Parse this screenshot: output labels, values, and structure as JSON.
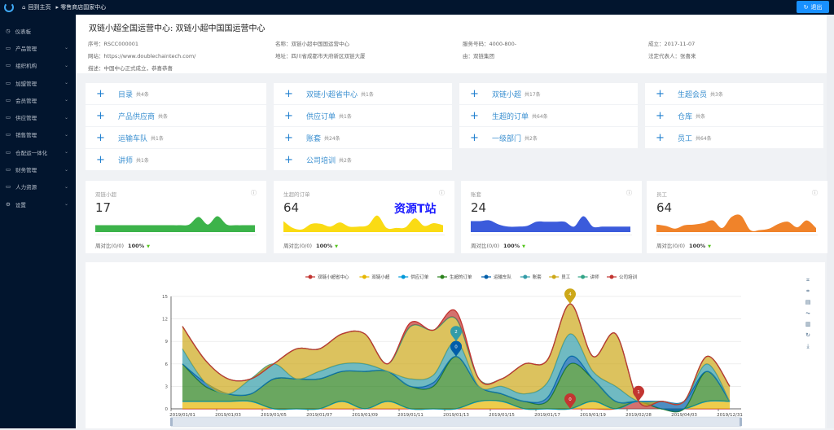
{
  "topbar": {
    "home": "回到主页",
    "breadcrumb": "零售商店国家中心",
    "logout": "退出"
  },
  "sidebar": {
    "items": [
      {
        "label": "仪表板",
        "icon": "dashboard-icon",
        "expandable": false
      },
      {
        "label": "产品管理",
        "icon": "folder-icon",
        "expandable": true
      },
      {
        "label": "组织机构",
        "icon": "folder-icon",
        "expandable": true
      },
      {
        "label": "加盟管理",
        "icon": "folder-icon",
        "expandable": true
      },
      {
        "label": "会员管理",
        "icon": "folder-icon",
        "expandable": true
      },
      {
        "label": "供应管理",
        "icon": "folder-icon",
        "expandable": true
      },
      {
        "label": "销售管理",
        "icon": "folder-icon",
        "expandable": true
      },
      {
        "label": "仓配运一体化",
        "icon": "folder-icon",
        "expandable": true
      },
      {
        "label": "财务管理",
        "icon": "folder-icon",
        "expandable": true
      },
      {
        "label": "人力资源",
        "icon": "folder-icon",
        "expandable": true
      },
      {
        "label": "设置",
        "icon": "gear-icon",
        "expandable": true
      }
    ]
  },
  "header": {
    "title": "双链小超全国运营中心: 双链小超中国国运营中心",
    "fields": [
      {
        "label": "序号：",
        "value": "RSCC000001"
      },
      {
        "label": "名称：",
        "value": "双链小超中国国运营中心"
      },
      {
        "label": "服务号码：",
        "value": "4000-800-"
      },
      {
        "label": "成立：",
        "value": "2017-11-07"
      },
      {
        "label": "网站：",
        "value": "https://www.doublechaintech.com/"
      },
      {
        "label": "地址：",
        "value": "四川省成都市天府新区双链大厦"
      },
      {
        "label": "由：",
        "value": "双链集团"
      },
      {
        "label": "法定代表人：",
        "value": "张喜来"
      },
      {
        "label": "描述：",
        "value": "中国中心正式成立，恭喜恭喜"
      }
    ]
  },
  "grid": [
    {
      "label": "目录",
      "count": "共4条"
    },
    {
      "label": "双链小超省中心",
      "count": "共1条"
    },
    {
      "label": "双链小超",
      "count": "共17条"
    },
    {
      "label": "生超会员",
      "count": "共3条"
    },
    {
      "label": "产品供应商",
      "count": "共条"
    },
    {
      "label": "供应订单",
      "count": "共1条"
    },
    {
      "label": "生超的订单",
      "count": "共64条"
    },
    {
      "label": "仓库",
      "count": "共条"
    },
    {
      "label": "运输车队",
      "count": "共1条"
    },
    {
      "label": "账套",
      "count": "共24条"
    },
    {
      "label": "一级部门",
      "count": "共2条"
    },
    {
      "label": "员工",
      "count": "共64条"
    },
    {
      "label": "讲师",
      "count": "共1条"
    },
    {
      "label": "公司培训",
      "count": "共2条"
    }
  ],
  "stats": [
    {
      "title": "双链小超",
      "value": "17",
      "compare": "周对比(0/0)",
      "percent": "100%",
      "color": "#3cb34a",
      "spark": [
        1,
        1,
        1,
        1,
        1,
        1,
        1,
        1,
        1,
        1,
        1.1,
        2.2,
        1.1,
        2.3,
        1.1,
        1,
        1,
        1
      ]
    },
    {
      "title": "生超的订单",
      "value": "64",
      "compare": "周对比(0/0)",
      "percent": "100%",
      "color": "#fadb14",
      "spark": [
        1.6,
        0.6,
        0.4,
        1.2,
        1.2,
        0.8,
        1.4,
        0.8,
        0.8,
        1,
        2.4,
        0.6,
        0.6,
        0.7,
        2,
        0.9,
        1.3,
        1
      ]
    },
    {
      "title": "账套",
      "value": "24",
      "compare": "周对比(0/0)",
      "percent": "100%",
      "color": "#3b5bdb",
      "spark": [
        1.6,
        1.6,
        1.7,
        1.1,
        0.8,
        0.8,
        0.9,
        1.5,
        1.5,
        1.5,
        1.5,
        0.8,
        2.3,
        0.8,
        0.8,
        0.8,
        0.8,
        0.8
      ]
    },
    {
      "title": "员工",
      "value": "64",
      "compare": "周对比(0/0)",
      "percent": "100%",
      "color": "#f0832a",
      "spark": [
        1.1,
        0.9,
        0.5,
        1,
        1.1,
        1.3,
        1.7,
        0.6,
        2.2,
        2.4,
        0.3,
        0.3,
        0.5,
        1.2,
        1.5,
        0.7,
        1.7,
        0.6
      ]
    }
  ],
  "watermark": "资源T站",
  "chart_data": {
    "type": "area",
    "stacked": true,
    "smooth": true,
    "categories": [
      "2019/01/01",
      "2019/01/02",
      "2019/01/03",
      "2019/01/04",
      "2019/01/05",
      "2019/01/06",
      "2019/01/07",
      "2019/01/08",
      "2019/01/09",
      "2019/01/10",
      "2019/01/11",
      "2019/01/12",
      "2019/01/13",
      "2019/01/14",
      "2019/01/15",
      "2019/01/16",
      "2019/01/17",
      "2019/01/18",
      "2019/01/19",
      "2019/01/20",
      "2019/02/28",
      "",
      "2019/04/03",
      "",
      "2019/12/31"
    ],
    "tick_labels": [
      "2019/01/01",
      "2019/01/03",
      "2019/01/05",
      "2019/01/07",
      "2019/01/09",
      "2019/01/11",
      "2019/01/13",
      "2019/01/15",
      "2019/01/17",
      "2019/01/19",
      "2019/02/28",
      "2019/04/03",
      "2019/12/31"
    ],
    "ylim": [
      0,
      15
    ],
    "yticks": [
      0,
      3,
      6,
      9,
      12,
      15
    ],
    "grid": true,
    "legend_position": "top",
    "series": [
      {
        "name": "双链小超省中心",
        "color": "#c23531",
        "values": [
          0,
          0,
          0,
          0,
          0,
          0,
          0,
          0,
          0,
          0,
          0,
          0,
          0,
          0,
          0,
          0,
          0,
          0,
          0,
          0,
          1,
          0,
          0,
          0,
          0
        ]
      },
      {
        "name": "双链小超",
        "color": "#e6b600",
        "values": [
          1,
          1,
          1,
          1,
          0,
          0,
          0,
          1,
          0,
          1,
          0,
          0,
          0,
          1,
          1,
          0,
          0,
          0,
          1,
          0,
          0,
          0,
          0,
          1,
          1
        ]
      },
      {
        "name": "供应订单",
        "color": "#0098d9",
        "values": [
          0,
          0,
          0,
          0,
          0,
          0,
          0,
          0,
          0,
          0,
          0,
          0,
          0,
          0,
          0,
          0,
          0,
          0,
          0,
          0,
          0,
          0,
          0,
          0,
          0
        ]
      },
      {
        "name": "生超的订单",
        "color": "#2b821d",
        "values": [
          5,
          2,
          1,
          1,
          4,
          4,
          4,
          4,
          5,
          4,
          3,
          3,
          7,
          2,
          1,
          1,
          1,
          6,
          3,
          1,
          0,
          0,
          0,
          4,
          0
        ]
      },
      {
        "name": "运输车队",
        "color": "#005eaa",
        "values": [
          0,
          0.5,
          0,
          0,
          0,
          0,
          0,
          0,
          0,
          0,
          0,
          0.5,
          0,
          0,
          0,
          0,
          0.5,
          1,
          0,
          0,
          0,
          1,
          1,
          0,
          0
        ]
      },
      {
        "name": "账套",
        "color": "#339ca8",
        "values": [
          2,
          0,
          0,
          2,
          2,
          0,
          1,
          1,
          1,
          0,
          1,
          1,
          2,
          0,
          1,
          1,
          2,
          3,
          1,
          2,
          0,
          0,
          0,
          1,
          0
        ]
      },
      {
        "name": "员工",
        "color": "#cda819",
        "values": [
          3,
          3,
          2,
          0,
          0,
          4,
          3,
          4,
          4,
          1,
          7,
          6,
          3,
          1,
          1,
          4,
          3,
          4,
          2,
          7,
          0,
          0,
          0,
          1,
          2
        ]
      },
      {
        "name": "讲师",
        "color": "#32a487",
        "values": [
          0,
          0,
          0,
          0,
          0,
          0,
          0,
          0,
          0,
          0,
          0,
          0,
          0,
          0,
          0,
          0,
          0,
          0,
          0,
          0,
          0,
          0,
          0,
          0,
          0
        ]
      },
      {
        "name": "公司培训",
        "color": "#c23531",
        "values": [
          0,
          0,
          0,
          0,
          0,
          0,
          0,
          0,
          0,
          0,
          0.5,
          0,
          1,
          0,
          0,
          0,
          0,
          0,
          0,
          0,
          0,
          0,
          0,
          0,
          0
        ]
      }
    ],
    "mark_points": [
      {
        "series": "生超的订单",
        "category": "2019/01/13",
        "value": "7"
      },
      {
        "series": "账套",
        "category": "2019/01/13",
        "value": "2"
      },
      {
        "series": "运输车队",
        "category": "2019/01/13",
        "value": "0"
      },
      {
        "series": "员工",
        "category": "2019/01/18",
        "value": "4"
      },
      {
        "series": "双链小超省中心",
        "category": "2019/01/18",
        "value": "0"
      },
      {
        "series": "双链小超省中心",
        "category": "2019/02/28",
        "value": "1"
      }
    ],
    "toolbox": [
      "crop-icon",
      "restore-crop-icon",
      "data-view-icon",
      "line-chart-icon",
      "bar-chart-icon",
      "refresh-icon",
      "download-icon"
    ]
  }
}
